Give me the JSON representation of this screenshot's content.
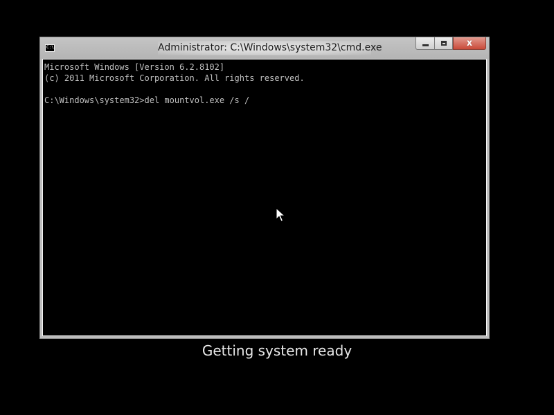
{
  "window": {
    "title": "Administrator: C:\\Windows\\system32\\cmd.exe",
    "icon": "cmd-icon",
    "icon_text": "C:\\",
    "controls": {
      "minimize_icon": "minimize-icon",
      "maximize_icon": "maximize-icon",
      "close_icon": "close-icon",
      "close_glyph": "x"
    },
    "colors": {
      "frame": "#bdbdbd",
      "close_button": "#c94a39"
    }
  },
  "console": {
    "lines": [
      "Microsoft Windows [Version 6.2.8102]",
      "(c) 2011 Microsoft Corporation. All rights reserved.",
      "",
      "C:\\Windows\\system32>del mountvol.exe /s /"
    ],
    "text_color": "#c0c0c0",
    "background": "#000000"
  },
  "status": {
    "message": "Getting system ready"
  },
  "pointer": {
    "icon": "mouse-pointer-icon"
  }
}
